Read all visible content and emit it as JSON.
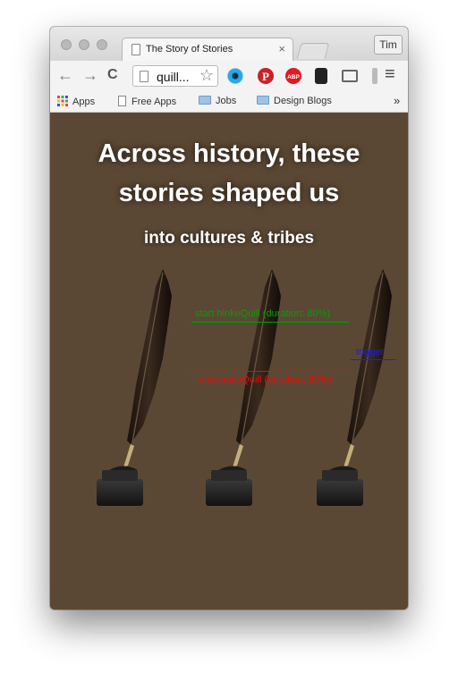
{
  "tab": {
    "title": "The Story of Stories",
    "close": "×"
  },
  "profile": {
    "name": "Tim"
  },
  "toolbar": {
    "back": "←",
    "forward": "→",
    "reload": "C",
    "url": "quill...",
    "star": "☆",
    "menu": "≡"
  },
  "bookmarks": {
    "items": [
      {
        "label": "Apps",
        "icon": "apps-grid-icon"
      },
      {
        "label": "Free Apps",
        "icon": "page-icon"
      },
      {
        "label": "Jobs",
        "icon": "folder-icon"
      },
      {
        "label": "Design Blogs",
        "icon": "folder-icon"
      }
    ],
    "overflow": "»"
  },
  "page": {
    "headline_line1": "Across history, these",
    "headline_line2": "stories shaped us",
    "subheading": "into cultures & tribes"
  },
  "markers": {
    "start": {
      "label": "start hinkeQuill (duration: 80%)",
      "color": "#00a000"
    },
    "trigger": {
      "label": "trigger",
      "color": "#1a1aff"
    },
    "end": {
      "label": "end moveQuill (duration: 80%)",
      "color": "#ff0000"
    }
  },
  "colors": {
    "page_background": "#5b4834",
    "text": "#ffffff"
  }
}
